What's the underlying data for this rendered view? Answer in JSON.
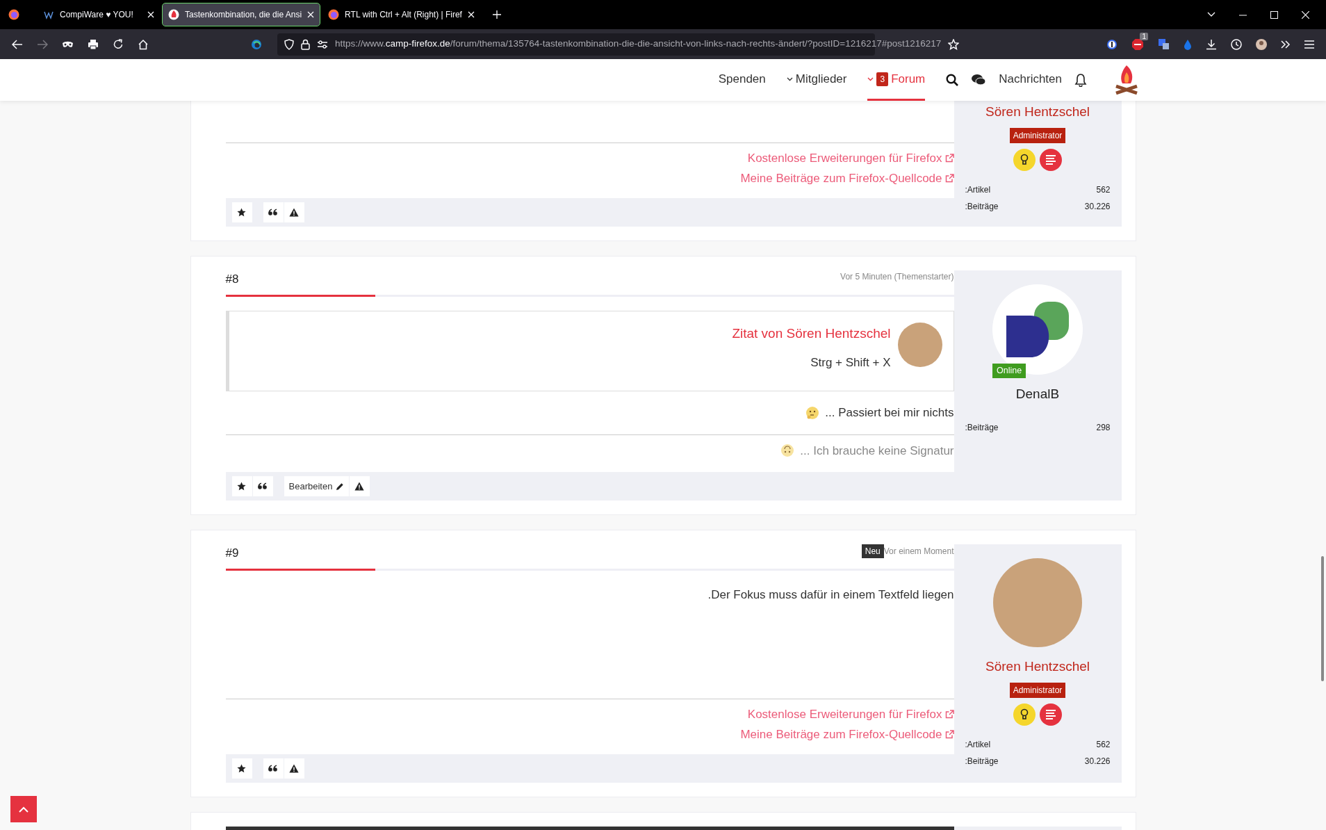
{
  "browser": {
    "tabs": [
      {
        "title": "CompiWare ♥ YOU!",
        "selected": false
      },
      {
        "title": "Tastenkombination, die die Ansi",
        "selected": true
      },
      {
        "title": "RTL with Ctrl + Alt (Right) | Firef",
        "selected": false
      }
    ],
    "url_prefix": "https://www.",
    "url_domain": "camp-firefox.de",
    "url_path": "/forum/thema/135764-tastenkombination-die-die-ansicht-von-links-nach-rechts-ändert/?postID=1216217#post1216217",
    "extension_badge": "1"
  },
  "site_nav": {
    "items": [
      {
        "label": "Spenden",
        "kind": "link",
        "selected": false
      },
      {
        "label": "Mitglieder",
        "kind": "dropdown",
        "selected": false
      },
      {
        "label": "Forum",
        "kind": "dropdown",
        "badge": "3",
        "selected": true
      }
    ],
    "messages_label": "Nachrichten"
  },
  "posts": [
    {
      "partial": true,
      "signature_links": [
        "Kostenlose Erweiterungen für Firefox",
        "Meine Beiträge zum Firefox-Quellcode"
      ],
      "button_groups": [
        [
          {
            "kind": "like"
          }
        ],
        [
          {
            "kind": "quote"
          },
          {
            "kind": "report"
          }
        ]
      ],
      "author": {
        "name": "Sören Hentzschel",
        "role": "Administrator",
        "online": false,
        "award_icons": true,
        "stats": [
          {
            "label": ":Artikel",
            "value": "562"
          },
          {
            "label": ":Beiträge",
            "value": "30.226"
          }
        ]
      }
    },
    {
      "number": "#8",
      "time": "Vor 5 Minuten (Themenstarter)",
      "quote": {
        "title": "Zitat von Sören Hentzschel",
        "text": "Strg + Shift + X"
      },
      "body": [
        {
          "kind": "emoji",
          "text": "... Passiert bei mir nichts"
        }
      ],
      "signature_text": "... Ich brauche keine Signatur",
      "button_groups": [
        [
          {
            "kind": "like"
          },
          {
            "kind": "quote"
          }
        ],
        [
          {
            "kind": "edit",
            "label": "Bearbeiten"
          },
          {
            "kind": "report"
          }
        ]
      ],
      "author": {
        "name": "DenalB",
        "online": true,
        "online_label": "Online",
        "award_icons": false,
        "stats": [
          {
            "label": ":Beiträge",
            "value": "298"
          }
        ]
      }
    },
    {
      "number": "#9",
      "new_badge": "Neu",
      "time": "Vor einem Moment",
      "body": [
        {
          "kind": "plain",
          "text": ".Der Fokus muss dafür in einem Textfeld liegen"
        }
      ],
      "signature_links": [
        "Kostenlose Erweiterungen für Firefox",
        "Meine Beiträge zum Firefox-Quellcode"
      ],
      "button_groups": [
        [
          {
            "kind": "like"
          }
        ],
        [
          {
            "kind": "quote"
          },
          {
            "kind": "report"
          }
        ]
      ],
      "author": {
        "name": "Sören Hentzschel",
        "role": "Administrator",
        "online": false,
        "award_icons": true,
        "stats": [
          {
            "label": ":Artikel",
            "value": "562"
          },
          {
            "label": ":Beiträge",
            "value": "30.226"
          }
        ]
      }
    }
  ]
}
